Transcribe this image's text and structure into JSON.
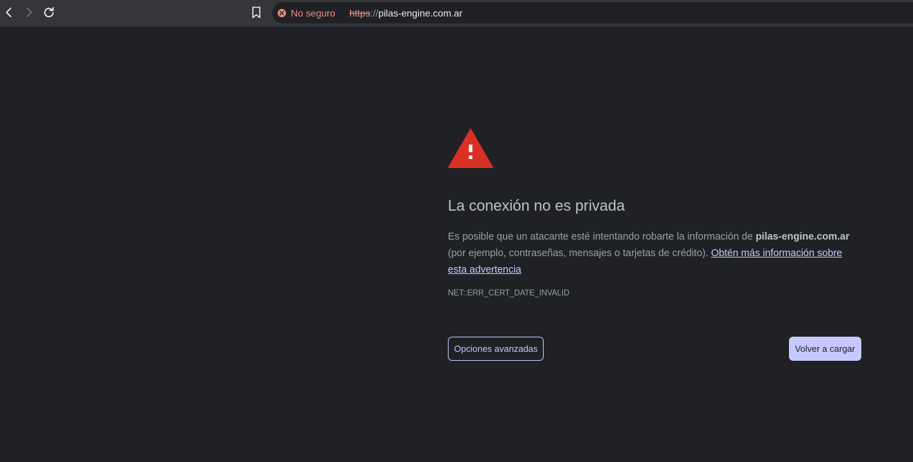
{
  "toolbar": {
    "back_icon": "chevron-left-icon",
    "forward_icon": "chevron-right-icon",
    "reload_icon": "reload-icon",
    "bookmark_icon": "bookmark-icon"
  },
  "omnibox": {
    "security_icon": "not-secure-x-icon",
    "security_label": "No seguro",
    "url_scheme": "https",
    "url_separator": "://",
    "url_host": "pilas-engine.com.ar"
  },
  "interstitial": {
    "icon": "warning-triangle-icon",
    "title": "La conexión no es privada",
    "desc_prefix": "Es posible que un atacante esté intentando robarte la información de ",
    "desc_host": "pilas-engine.com.ar",
    "desc_middle": " (por ejemplo, contraseñas, mensajes o tarjetas de crédito). ",
    "learn_more_link": "Obtén más información sobre esta advertencia",
    "error_code": "NET::ERR_CERT_DATE_INVALID",
    "advanced_button": "Opciones avanzadas",
    "reload_button": "Volver a cargar"
  },
  "colors": {
    "page_bg": "#202124",
    "toolbar_bg": "#35363a",
    "warning_red": "#d93025",
    "not_secure_red": "#f28b82",
    "accent": "#c6c9ff"
  }
}
